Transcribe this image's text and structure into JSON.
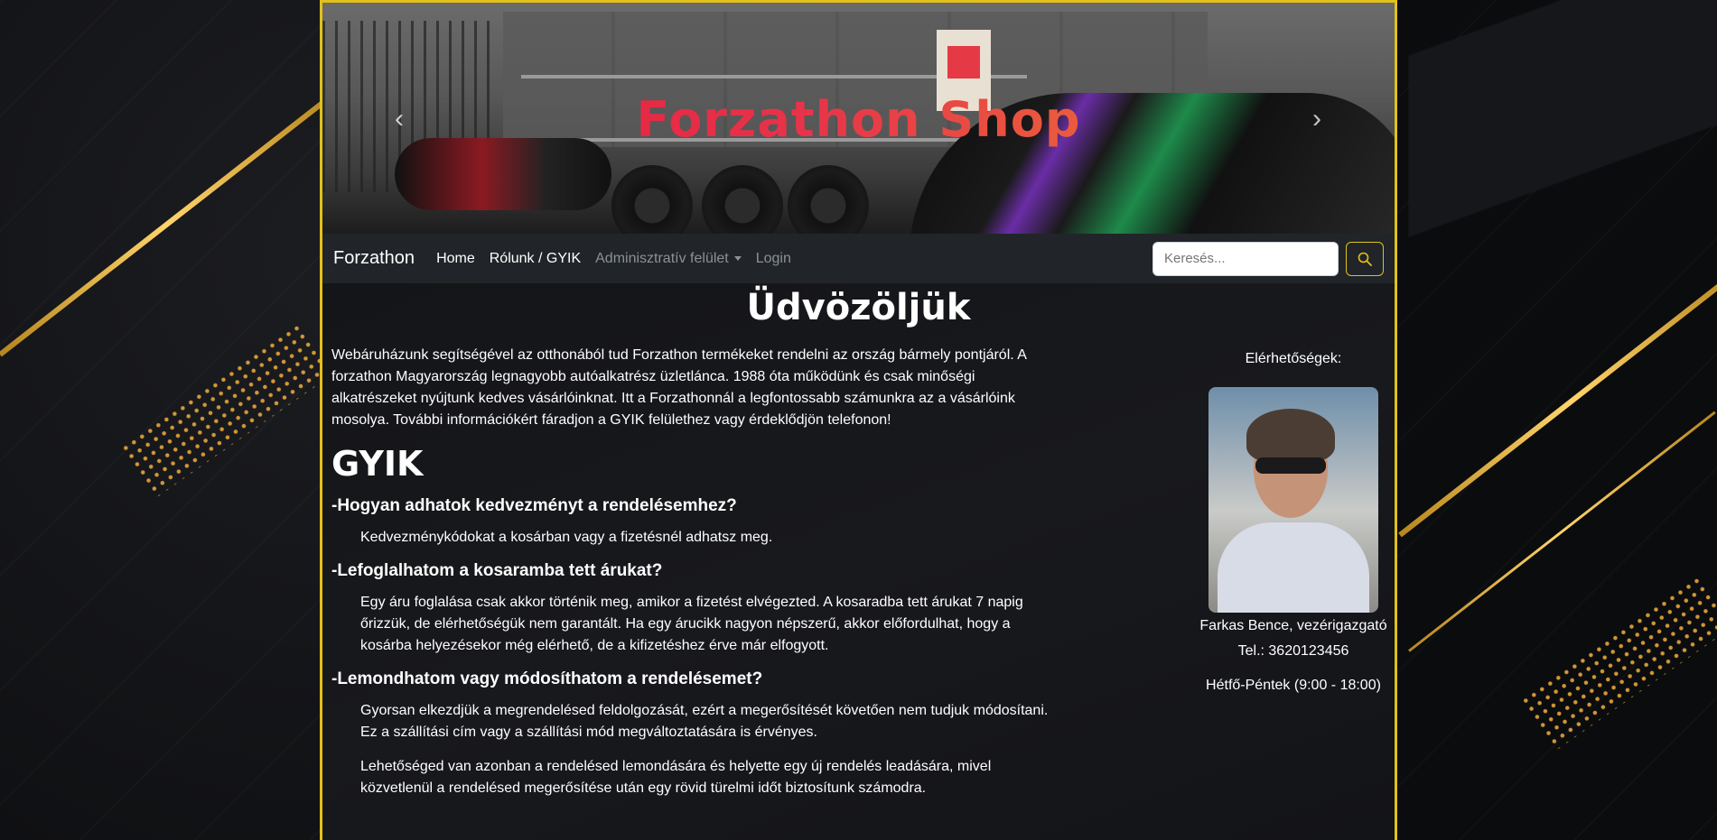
{
  "hero": {
    "title": "Forzathon Shop",
    "prev_icon": "chevron-left",
    "next_icon": "chevron-right"
  },
  "navbar": {
    "brand": "Forzathon",
    "links": [
      {
        "label": "Home"
      },
      {
        "label": "Rólunk / GYIK"
      },
      {
        "label": "Adminisztratív felület"
      },
      {
        "label": "Login"
      }
    ],
    "search_placeholder": "Keresés...",
    "search_icon": "search-icon"
  },
  "main": {
    "title": "Üdvözöljük",
    "intro": "Webáruházunk segítségével az otthonából tud Forzathon termékeket rendelni az ország bármely pontjáról. A forzathon Magyarország legnagyobb autóalkatrész üzletlánca. 1988 óta működünk és csak minőségi alkatrészeket nyújtunk kedves vásárlóinknat. Itt a Forzathonnál a legfontossabb számunkra az a vásárlóink mosolya. További információkért fáradjon a GYIK felülethez vagy érdeklődjön telefonon!",
    "faq_title": "GYIK",
    "faq": [
      {
        "q": "-Hogyan adhatok kedvezményt a rendelésemhez?",
        "a": [
          "Kedvezménykódokat a kosárban vagy a fizetésnél adhatsz meg."
        ]
      },
      {
        "q": "-Lefoglalhatom a kosaramba tett árukat?",
        "a": [
          "Egy áru foglalása csak akkor történik meg, amikor a fizetést elvégezted. A kosaradba tett árukat 7 napig őrizzük, de elérhetőségük nem garantált. Ha egy árucikk nagyon népszerű, akkor előfordulhat, hogy a kosárba helyezésekor még elérhető, de a kifizetéshez érve már elfogyott."
        ]
      },
      {
        "q": "-Lemondhatom vagy módosíthatom a rendelésemet?",
        "a": [
          "Gyorsan elkezdjük a megrendelésed feldolgozását, ezért a megerősítését követően nem tudjuk módosítani. Ez a szállítási cím vagy a szállítási mód megváltoztatására is érvényes.",
          "Lehetőséged van azonban a rendelésed lemondására és helyette egy új rendelés leadására, mivel közvetlenül a rendelésed megerősítése után egy rövid türelmi időt biztosítunk számodra."
        ]
      }
    ]
  },
  "contact": {
    "label": "Elérhetőségek:",
    "name": "Farkas Bence, vezérigazgató",
    "phone": "Tel.: 3620123456",
    "hours": "Hétfő-Péntek (9:00 - 18:00)"
  },
  "colors": {
    "frame_border": "#e2c11a",
    "navbar_bg": "#212529",
    "title_gradient_start": "#e0183c",
    "title_gradient_end": "#ec8a2e"
  }
}
